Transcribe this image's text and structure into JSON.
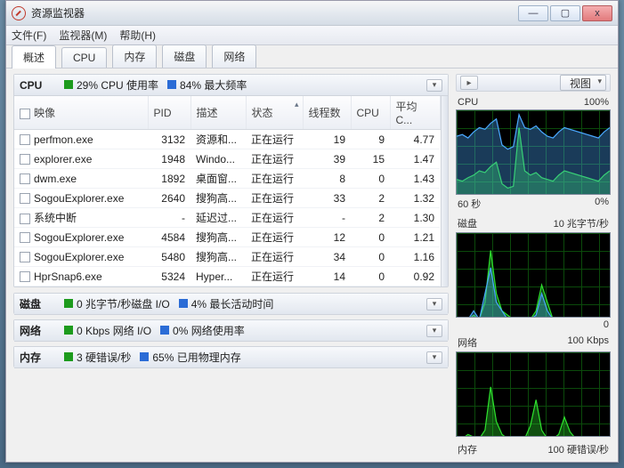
{
  "window": {
    "title": "资源监视器",
    "minimize": "—",
    "maximize": "▢",
    "close": "x"
  },
  "menu": {
    "file": "文件(F)",
    "monitor": "监视器(M)",
    "help": "帮助(H)"
  },
  "tabs": [
    "概述",
    "CPU",
    "内存",
    "磁盘",
    "网络"
  ],
  "cpu_section": {
    "title": "CPU",
    "usage_label": "29% CPU 使用率",
    "maxfreq_label": "84% 最大频率",
    "columns": [
      "映像",
      "PID",
      "描述",
      "状态",
      "线程数",
      "CPU",
      "平均 C..."
    ],
    "rows": [
      {
        "img": "perfmon.exe",
        "pid": "3132",
        "desc": "资源和...",
        "stat": "正在运行",
        "threads": "19",
        "cpu": "9",
        "avg": "4.77"
      },
      {
        "img": "explorer.exe",
        "pid": "1948",
        "desc": "Windo...",
        "stat": "正在运行",
        "threads": "39",
        "cpu": "15",
        "avg": "1.47"
      },
      {
        "img": "dwm.exe",
        "pid": "1892",
        "desc": "桌面窗...",
        "stat": "正在运行",
        "threads": "8",
        "cpu": "0",
        "avg": "1.43"
      },
      {
        "img": "SogouExplorer.exe",
        "pid": "2640",
        "desc": "搜狗高...",
        "stat": "正在运行",
        "threads": "33",
        "cpu": "2",
        "avg": "1.32"
      },
      {
        "img": "系统中断",
        "pid": "-",
        "desc": "延迟过...",
        "stat": "正在运行",
        "threads": "-",
        "cpu": "2",
        "avg": "1.30"
      },
      {
        "img": "SogouExplorer.exe",
        "pid": "4584",
        "desc": "搜狗高...",
        "stat": "正在运行",
        "threads": "12",
        "cpu": "0",
        "avg": "1.21"
      },
      {
        "img": "SogouExplorer.exe",
        "pid": "5480",
        "desc": "搜狗高...",
        "stat": "正在运行",
        "threads": "34",
        "cpu": "0",
        "avg": "1.16"
      },
      {
        "img": "HprSnap6.exe",
        "pid": "5324",
        "desc": "Hyper...",
        "stat": "正在运行",
        "threads": "14",
        "cpu": "0",
        "avg": "0.92"
      }
    ]
  },
  "disk_section": {
    "title": "磁盘",
    "stat1": "0 兆字节/秒磁盘 I/O",
    "stat2": "4% 最长活动时间"
  },
  "net_section": {
    "title": "网络",
    "stat1": "0 Kbps 网络 I/O",
    "stat2": "0% 网络使用率"
  },
  "mem_section": {
    "title": "内存",
    "stat1": "3 硬错误/秒",
    "stat2": "65% 已用物理内存"
  },
  "right": {
    "view_label": "视图",
    "cpu": {
      "top_left": "CPU",
      "top_right": "100%",
      "bottom_left": "60 秒",
      "bottom_right": "0%"
    },
    "disk": {
      "top_left": "磁盘",
      "top_right": "10 兆字节/秒",
      "bottom_left": "",
      "bottom_right": "0"
    },
    "net": {
      "top_left": "网络",
      "top_right": "100 Kbps",
      "bottom_left": "",
      "bottom_right": ""
    },
    "mem": {
      "top_left": "内存",
      "top_right": "100 硬错误/秒",
      "bottom_left": "",
      "bottom_right": ""
    }
  },
  "chart_data": [
    {
      "type": "line",
      "title": "CPU",
      "ylim": [
        0,
        100
      ],
      "series": [
        {
          "name": "usage",
          "values": [
            20,
            18,
            22,
            25,
            30,
            28,
            35,
            40,
            15,
            10,
            12,
            80,
            30,
            25,
            28,
            22,
            20,
            18,
            25,
            30,
            28,
            26,
            24,
            22,
            20,
            18,
            25,
            30
          ]
        },
        {
          "name": "maxfreq",
          "values": [
            70,
            72,
            68,
            75,
            80,
            78,
            85,
            90,
            60,
            55,
            58,
            95,
            80,
            78,
            82,
            75,
            70,
            68,
            75,
            80,
            78,
            76,
            74,
            72,
            70,
            68,
            75,
            80
          ]
        }
      ]
    },
    {
      "type": "line",
      "title": "磁盘",
      "ylim": [
        0,
        10
      ],
      "series": [
        {
          "name": "io",
          "values": [
            0,
            0,
            0,
            0.5,
            0,
            2,
            8,
            3,
            1,
            0.5,
            0,
            0,
            0,
            0,
            1,
            4,
            2,
            0,
            0,
            0,
            0,
            0,
            0,
            0,
            0,
            0,
            0,
            0
          ]
        },
        {
          "name": "active",
          "values": [
            0,
            0,
            0,
            1,
            0,
            3,
            6,
            2,
            1,
            0,
            0,
            0,
            0,
            0,
            0.5,
            3,
            1,
            0,
            0,
            0,
            0,
            0,
            0,
            0,
            0,
            0,
            0,
            0
          ]
        }
      ]
    },
    {
      "type": "line",
      "title": "网络",
      "ylim": [
        0,
        100
      ],
      "series": [
        {
          "name": "io",
          "values": [
            0,
            0,
            5,
            2,
            0,
            10,
            60,
            20,
            5,
            0,
            0,
            0,
            0,
            15,
            45,
            10,
            0,
            0,
            5,
            25,
            8,
            0,
            0,
            0,
            0,
            0,
            0,
            0
          ]
        }
      ]
    }
  ]
}
